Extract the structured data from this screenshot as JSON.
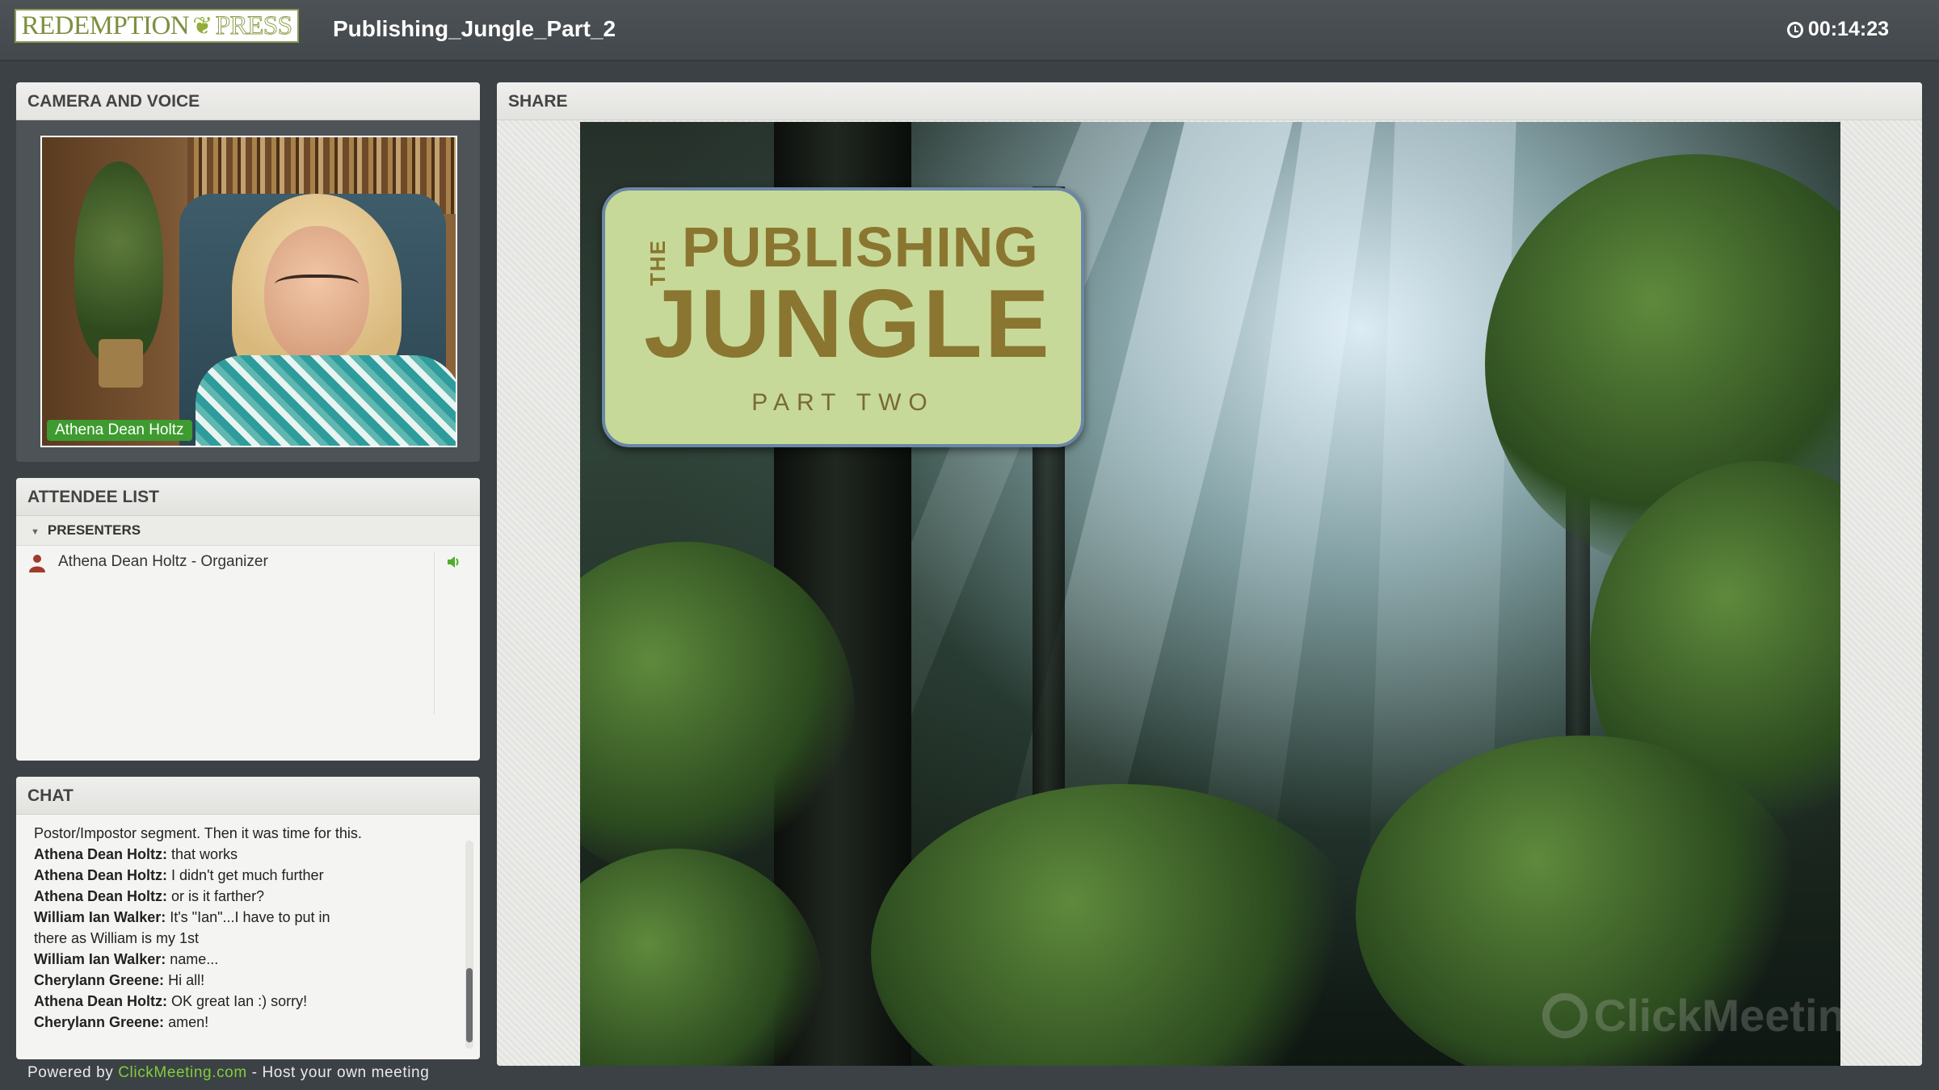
{
  "header": {
    "logo_main": "REDEMPTION",
    "logo_press": "PRESS",
    "meeting_title": "Publishing_Jungle_Part_2",
    "elapsed_time": "00:14:23"
  },
  "camera_panel": {
    "title": "CAMERA AND VOICE",
    "presenter_name": "Athena Dean Holtz"
  },
  "attendee_panel": {
    "title": "ATTENDEE LIST",
    "group_label": "PRESENTERS",
    "attendees": [
      {
        "name": "Athena Dean Holtz - Organizer",
        "role_icon": "person-icon",
        "audio_icon": "speaker-icon"
      }
    ]
  },
  "chat_panel": {
    "title": "CHAT",
    "messages": [
      {
        "sender": "",
        "text": "Postor/Impostor segment. Then it was time for this."
      },
      {
        "sender": "Athena Dean Holtz:",
        "text": "that works"
      },
      {
        "sender": "Athena Dean Holtz:",
        "text": "I didn't get much further"
      },
      {
        "sender": "Athena Dean Holtz:",
        "text": "or is it farther?"
      },
      {
        "sender": "William Ian Walker:",
        "text": "It's \"Ian\"...I have to put in"
      },
      {
        "sender": "",
        "text": "there as William is my 1st"
      },
      {
        "sender": "William Ian Walker:",
        "text": "name..."
      },
      {
        "sender": "Cherylann Greene:",
        "text": "Hi all!"
      },
      {
        "sender": "Athena Dean Holtz:",
        "text": "OK great Ian :) sorry!"
      },
      {
        "sender": "Cherylann Greene:",
        "text": "amen!"
      }
    ]
  },
  "footer": {
    "powered_by": "Powered by",
    "link_text": "ClickMeeting.com",
    "suffix": "- Host your own meeting"
  },
  "share_panel": {
    "title": "SHARE",
    "slide": {
      "title_the": "THE",
      "title_main": "PUBLISHING",
      "title_big": "JUNGLE",
      "subtitle": "PART TWO"
    },
    "watermark": "ClickMeeting"
  },
  "colors": {
    "topbar": "#474c50",
    "accent_green": "#3d9b2f",
    "link_green": "#7fcf3b",
    "slide_title_bg": "#c7d998",
    "slide_title_text": "#8a7630"
  }
}
